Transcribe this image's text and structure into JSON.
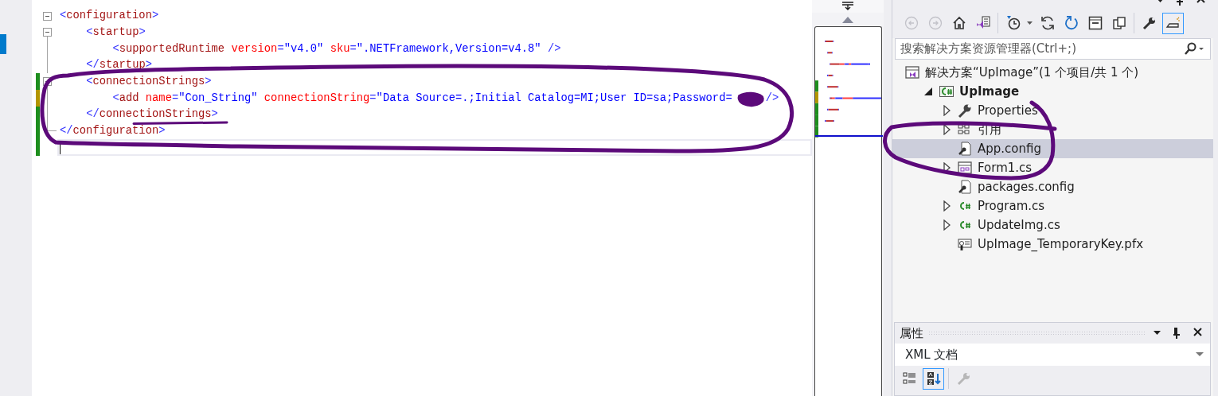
{
  "editor": {
    "lines": [
      {
        "collapsible": true,
        "fold_end": false,
        "tokens": [
          {
            "kind": "bracket",
            "text": "<"
          },
          {
            "kind": "element",
            "text": "configuration"
          },
          {
            "kind": "bracket",
            "text": ">"
          }
        ],
        "children": [
          {
            "collapsible": true,
            "fold_end": false,
            "tokens": [
              {
                "kind": "bracket",
                "text": "<"
              },
              {
                "kind": "element",
                "text": "startup"
              },
              {
                "kind": "bracket",
                "text": ">"
              }
            ],
            "children": [
              {
                "collapsible": false,
                "fold_end": false,
                "tokens": [
                  {
                    "kind": "bracket",
                    "text": "<"
                  },
                  {
                    "kind": "element",
                    "text": "supportedRuntime"
                  },
                  {
                    "kind": "attr",
                    "text": " version"
                  },
                  {
                    "kind": "bracket",
                    "text": "="
                  },
                  {
                    "kind": "value",
                    "text": "\"v4.0\""
                  },
                  {
                    "kind": "attr",
                    "text": " sku"
                  },
                  {
                    "kind": "bracket",
                    "text": "="
                  },
                  {
                    "kind": "value",
                    "text": "\".NETFramework,Version=v4.8\""
                  },
                  {
                    "kind": "bracket",
                    "text": " />"
                  }
                ]
              }
            ]
          },
          {
            "collapsible": false,
            "fold_end": false,
            "tokens": [
              {
                "kind": "bracket",
                "text": "</"
              },
              {
                "kind": "element",
                "text": "startup"
              },
              {
                "kind": "bracket",
                "text": ">"
              }
            ]
          },
          {
            "collapsible": true,
            "fold_end": false,
            "color": "#1e8e1e",
            "tokens": [
              {
                "kind": "bracket",
                "text": "<"
              },
              {
                "kind": "element",
                "text": "connectionStrings"
              },
              {
                "kind": "bracket",
                "text": ">"
              }
            ],
            "children": [
              {
                "collapsible": false,
                "fold_end": false,
                "color": "#b39600",
                "tokens": [
                  {
                    "kind": "bracket",
                    "text": "<"
                  },
                  {
                    "kind": "element",
                    "text": "add"
                  },
                  {
                    "kind": "attr",
                    "text": " name"
                  },
                  {
                    "kind": "bracket",
                    "text": "="
                  },
                  {
                    "kind": "value",
                    "text": "\"Con_String\""
                  },
                  {
                    "kind": "attr",
                    "text": " connectionString"
                  },
                  {
                    "kind": "bracket",
                    "text": "="
                  },
                  {
                    "kind": "value",
                    "text": "\"Data Source=.;Initial Catalog=MI;User ID=sa;Password="
                  }
                ],
                "tail": [
                  {
                    "kind": "bracket",
                    "text": "/>"
                  }
                ]
              }
            ]
          },
          {
            "collapsible": false,
            "fold_end": false,
            "color": "#1e8e1e",
            "tokens": [
              {
                "kind": "bracket",
                "text": "</"
              },
              {
                "kind": "element",
                "text": "connectionStrings"
              },
              {
                "kind": "bracket",
                "text": ">"
              }
            ]
          }
        ]
      },
      {
        "collapsible": false,
        "fold_end": true,
        "color": "#1e8e1e",
        "tokens": [
          {
            "kind": "bracket",
            "text": "</"
          },
          {
            "kind": "element",
            "text": "configuration"
          },
          {
            "kind": "bracket",
            "text": ">"
          }
        ]
      },
      {
        "collapsible": false,
        "fold_end": false,
        "color": "#1e8e1e",
        "current": true
      }
    ]
  },
  "solution_explorer": {
    "toolbar": [
      {
        "kind": "back",
        "disabled": true,
        "selected": false
      },
      {
        "kind": "forward",
        "disabled": true,
        "selected": false
      },
      {
        "kind": "home",
        "disabled": false,
        "selected": false
      },
      {
        "kind": "switch-views",
        "disabled": false,
        "selected": false
      },
      {
        "kind": "pending-changes",
        "disabled": false,
        "selected": false
      },
      {
        "kind": "dropdown",
        "disabled": false,
        "selected": false
      },
      {
        "kind": "sync",
        "disabled": false,
        "selected": false
      },
      {
        "kind": "refresh",
        "disabled": false,
        "selected": false
      },
      {
        "kind": "collapse",
        "disabled": false,
        "selected": false
      },
      {
        "kind": "copy",
        "disabled": false,
        "selected": false
      },
      {
        "kind": "properties",
        "disabled": false,
        "selected": false
      },
      {
        "kind": "preview",
        "disabled": false,
        "selected": true
      }
    ],
    "search": {
      "placeholder": "搜索解决方案资源管理器(Ctrl+;)"
    },
    "tree": [
      {
        "label": "解决方案“UpImage”(1 个项目/共 1 个)",
        "kind": "solution",
        "expandable": false,
        "selected": false,
        "bold": false,
        "children": [
          {
            "label": "UpImage",
            "kind": "project",
            "expandable": true,
            "expanded": true,
            "selected": false,
            "bold": true,
            "children": [
              {
                "label": "Properties",
                "kind": "wrench",
                "expandable": true,
                "expanded": false,
                "selected": false,
                "bold": false
              },
              {
                "label": "引用",
                "kind": "references",
                "expandable": true,
                "expanded": false,
                "selected": false,
                "bold": false
              },
              {
                "label": "App.config",
                "kind": "config",
                "expandable": false,
                "selected": true,
                "bold": false
              },
              {
                "label": "Form1.cs",
                "kind": "form",
                "expandable": true,
                "expanded": false,
                "selected": false,
                "bold": false
              },
              {
                "label": "packages.config",
                "kind": "config",
                "expandable": false,
                "selected": false,
                "bold": false
              },
              {
                "label": "Program.cs",
                "kind": "csharp",
                "expandable": true,
                "expanded": false,
                "selected": false,
                "bold": false
              },
              {
                "label": "UpdateImg.cs",
                "kind": "csharp",
                "expandable": true,
                "expanded": false,
                "selected": false,
                "bold": false
              },
              {
                "label": "UpImage_TemporaryKey.pfx",
                "kind": "certificate",
                "expandable": false,
                "selected": false,
                "bold": false
              }
            ]
          }
        ]
      }
    ]
  },
  "properties": {
    "title": "属性",
    "object": "XML 文档",
    "toolbar": [
      {
        "kind": "categorized",
        "disabled": false,
        "selected": false
      },
      {
        "kind": "alphabetical",
        "disabled": false,
        "selected": true
      },
      {
        "kind": "property-pages",
        "disabled": true,
        "selected": false
      }
    ]
  }
}
